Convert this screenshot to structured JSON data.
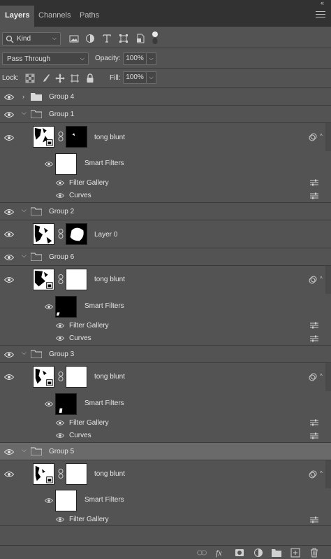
{
  "tabs": [
    {
      "label": "Layers",
      "active": true
    },
    {
      "label": "Channels",
      "active": false
    },
    {
      "label": "Paths",
      "active": false
    }
  ],
  "filter": {
    "kind_label": "Kind",
    "icons": [
      "image-filter-icon",
      "adjustment-filter-icon",
      "type-filter-icon",
      "shape-filter-icon",
      "smart-object-filter-icon",
      "filter-toggle-icon"
    ]
  },
  "blend": {
    "mode": "Pass Through",
    "opacity_label": "Opacity:",
    "opacity_value": "100%",
    "lock_label": "Lock:",
    "fill_label": "Fill:",
    "fill_value": "100%"
  },
  "layers": [
    {
      "name": "Group 4"
    },
    {
      "name": "Group 1"
    },
    {
      "name": "tong blunt"
    },
    {
      "name": "Smart Filters"
    },
    {
      "name": "Filter Gallery"
    },
    {
      "name": "Curves"
    },
    {
      "name": "Group 2"
    },
    {
      "name": "Layer 0"
    },
    {
      "name": "Group 6"
    },
    {
      "name": "tong blunt"
    },
    {
      "name": "Smart Filters"
    },
    {
      "name": "Filter Gallery"
    },
    {
      "name": "Curves"
    },
    {
      "name": "Group 3"
    },
    {
      "name": "tong blunt"
    },
    {
      "name": "Smart Filters"
    },
    {
      "name": "Filter Gallery"
    },
    {
      "name": "Curves"
    },
    {
      "name": "Group 5"
    },
    {
      "name": "tong blunt"
    },
    {
      "name": "Smart Filters"
    },
    {
      "name": "Filter Gallery"
    }
  ],
  "colors": {
    "panel_bg": "#535353",
    "tab_bar_bg": "#323232",
    "selected_row_bg": "#6a6a6a"
  }
}
